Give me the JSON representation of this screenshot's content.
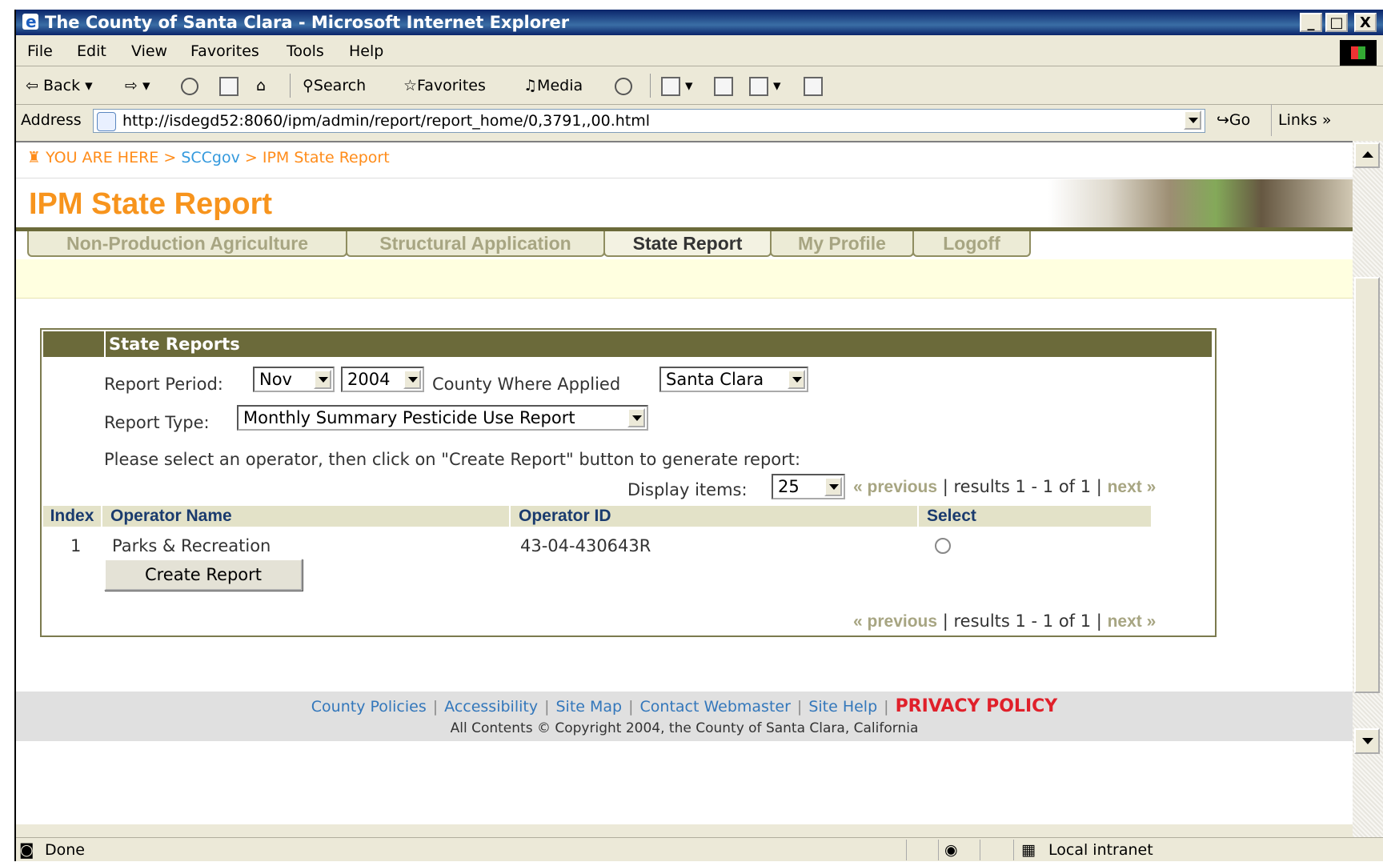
{
  "window": {
    "title": "The County of Santa Clara - Microsoft Internet Explorer",
    "minimize": "_",
    "maximize": "□",
    "close": "X"
  },
  "menu": [
    "File",
    "Edit",
    "View",
    "Favorites",
    "Tools",
    "Help"
  ],
  "toolbar": {
    "back": "Back",
    "search": "Search",
    "favorites": "Favorites",
    "media": "Media"
  },
  "address": {
    "label": "Address",
    "url": "http://isdegd52:8060/ipm/admin/report/report_home/0,3791,,00.html",
    "go": "Go",
    "links": "Links"
  },
  "breadcrumb": {
    "you_are_here": "YOU ARE HERE",
    "sep": ">",
    "home": "SCCgov",
    "current": "IPM State Report"
  },
  "page_title": "IPM State Report",
  "tabs": [
    {
      "label": "Non-Production Agriculture",
      "active": false
    },
    {
      "label": "Structural Application",
      "active": false
    },
    {
      "label": "State Report",
      "active": true
    },
    {
      "label": "My Profile",
      "active": false
    },
    {
      "label": "Logoff",
      "active": false
    }
  ],
  "panel": {
    "heading": "State Reports",
    "report_period_label": "Report Period:",
    "month": "Nov",
    "year": "2004",
    "county_label": "County Where Applied",
    "county": "Santa Clara",
    "report_type_label": "Report Type:",
    "report_type": "Monthly Summary Pesticide Use Report",
    "instruction": "Please select an operator, then click on \"Create Report\" button to generate report:",
    "display_items_label": "Display items:",
    "display_items": "25",
    "pager": {
      "previous": "« previous",
      "results": "| results 1 - 1 of 1 |",
      "next": "next »"
    },
    "table": {
      "headers": [
        "Index",
        "Operator Name",
        "Operator ID",
        "Select"
      ],
      "rows": [
        {
          "index": "1",
          "name": "Parks & Recreation",
          "id": "43-04-430643R"
        }
      ]
    },
    "create_button": "Create Report"
  },
  "footer": {
    "links": [
      "County Policies",
      "Accessibility",
      "Site Map",
      "Contact Webmaster",
      "Site Help"
    ],
    "privacy": "PRIVACY POLICY",
    "copyright": "All Contents © Copyright 2004, the County of Santa Clara, California"
  },
  "status": {
    "text": "Done",
    "zone": "Local intranet"
  }
}
